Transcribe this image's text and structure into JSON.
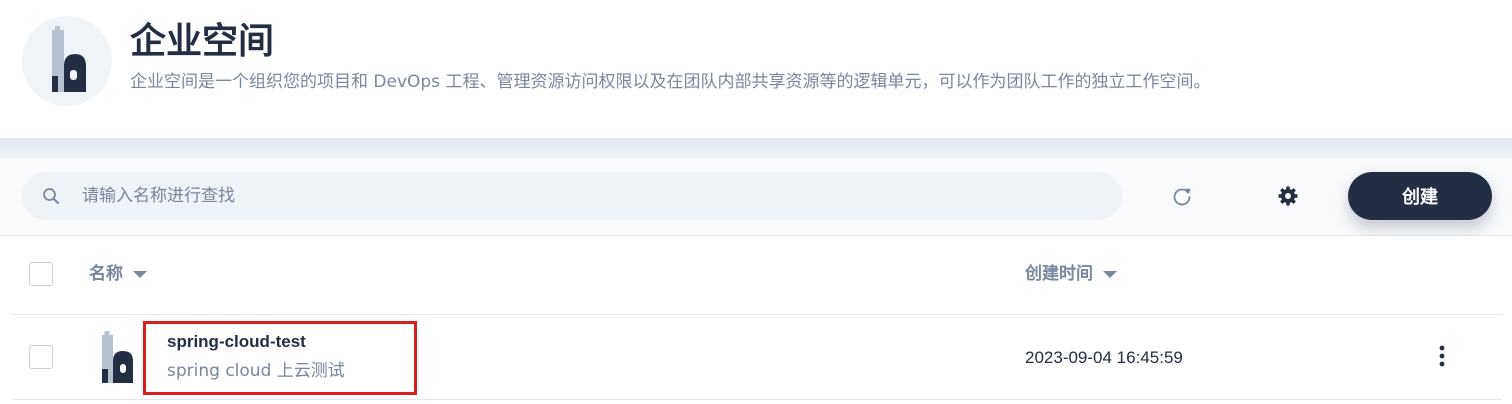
{
  "header": {
    "title": "企业空间",
    "description": "企业空间是一个组织您的项目和 DevOps 工程、管理资源访问权限以及在团队内部共享资源等的逻辑单元，可以作为团队工作的独立工作空间。",
    "logo_icon": "workspace-building-icon"
  },
  "toolbar": {
    "search_placeholder": "请输入名称进行查找",
    "search_value": "",
    "refresh_icon": "refresh-icon",
    "settings_icon": "gear-icon",
    "create_label": "创建"
  },
  "table": {
    "columns": [
      {
        "label": "名称",
        "sortable": true
      },
      {
        "label": "创建时间",
        "sortable": true
      }
    ],
    "rows": [
      {
        "name": "spring-cloud-test",
        "description": "spring cloud 上云测试",
        "created_at": "2023-09-04 16:45:59",
        "icon": "workspace-building-icon"
      }
    ]
  },
  "colors": {
    "primary": "#242e42",
    "muted": "#79879c",
    "background": "#eff4f9",
    "highlight": "#d81e1e"
  }
}
